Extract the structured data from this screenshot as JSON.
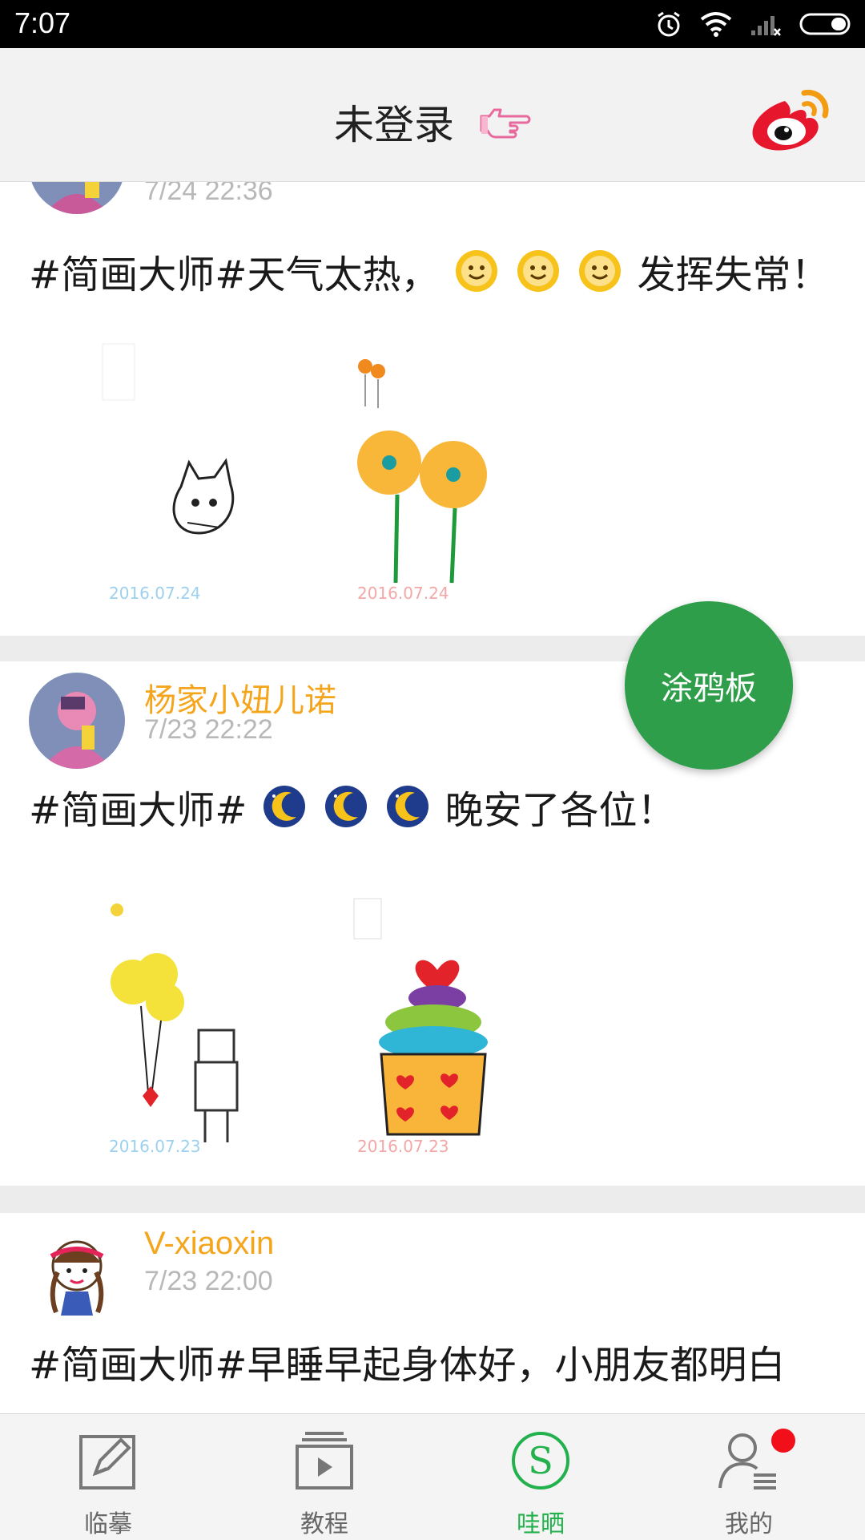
{
  "status_bar": {
    "time": "7:07"
  },
  "header": {
    "title": "未登录"
  },
  "fab": {
    "label": "涂鸦板"
  },
  "posts": [
    {
      "time": "7/24 22:36",
      "text_before": "#简画大师#天气太热，",
      "emoji": "smiley-icon",
      "text_after": "发挥失常！"
    },
    {
      "author": "杨家小妞儿诺",
      "time": "7/23 22:22",
      "text_before": "#简画大师#",
      "emoji": "moon-icon",
      "text_after": "晚安了各位！"
    },
    {
      "author": "V-xiaoxin",
      "time": "7/23 22:00",
      "text_before": "#简画大师#早睡早起身体好，小朋友都明白"
    }
  ],
  "bottom_nav": [
    {
      "label": "临摹",
      "icon": "pencil-icon"
    },
    {
      "label": "教程",
      "icon": "play-icon"
    },
    {
      "label": "哇晒",
      "icon": "share-s-icon",
      "active": true
    },
    {
      "label": "我的",
      "icon": "user-icon"
    }
  ],
  "colors": {
    "accent": "#22b14c",
    "fab": "#2f9e4b",
    "author": "#f4a51c",
    "badge": "#f10f1a"
  }
}
